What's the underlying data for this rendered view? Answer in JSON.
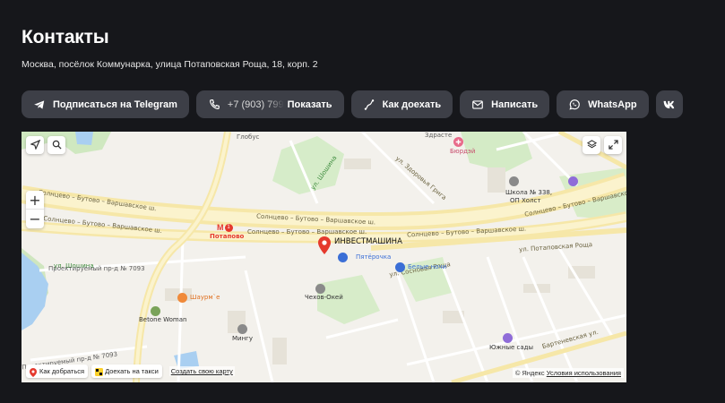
{
  "page": {
    "title": "Контакты",
    "address": "Москва, посёлок Коммунарка, улица Потаповская Роща, 18, корп. 2"
  },
  "actions": {
    "telegram": {
      "label": "Подписаться на Telegram",
      "icon": "telegram-icon"
    },
    "phone": {
      "number": "+7 (903) 799",
      "label": "Показать",
      "icon": "phone-icon"
    },
    "route": {
      "label": "Как доехать",
      "icon": "route-icon"
    },
    "write": {
      "label": "Написать",
      "icon": "mail-icon"
    },
    "whatsapp": {
      "label": "WhatsApp",
      "icon": "whatsapp-icon"
    },
    "vk": {
      "icon": "vk-icon"
    }
  },
  "map": {
    "marker_label": "ИНВЕСТМАШИНА",
    "labels": {
      "globus": "Глобус",
      "zdorove": "Здрасте",
      "byurdaj": "Бюрдэй",
      "school": "Школа № 338,",
      "school2": "ОП Холст",
      "shosh1": "ул. Шошина",
      "shosh2": "ул. Шошина",
      "metro": "Потапово",
      "pyaterochka": "Пятёрочка",
      "belye_nochi": "Белые ночи",
      "shaurme": "Шаурм`е",
      "betone": "Betone Woman",
      "chehov": "Чехов-Окей",
      "mingu": "Мингу",
      "yuzhnye_sady": "Южные сады",
      "proezd1": "Проектируемый пр-д № 7093",
      "proezd2": "Проектируемый пр-д № 7093",
      "road1": "Солнцево – Бутово – Варшавское ш.",
      "road2": "Солнцево – Бутово – Варшавское ш.",
      "road3": "Солнцево – Бутово – Варшавское ш.",
      "road4": "Солнцево – Бутово – Варшавское ш.",
      "road5": "Солнцево – Бутово – Варшавское ш.",
      "road6": "Солнцево – Бутово – Варшавское ш.",
      "zdravie": "ул. Здоровья Грига",
      "potap": "ул. Потаповская Роща",
      "sosnov": "ул. Сосновая Роща",
      "bartenev": "Бартеневская ул."
    },
    "controls": {
      "locate_icon": "locate-arrow-icon",
      "search_icon": "search-icon",
      "layers_icon": "layers-icon",
      "fullscreen_icon": "fullscreen-icon",
      "zoom_in": "+",
      "zoom_out": "−"
    },
    "bottom": {
      "route": "Как добраться",
      "taxi": "Доехать на такси",
      "create": "Создать свою карту",
      "copyright": "© Яндекс",
      "terms": "Условия использования"
    }
  },
  "colors": {
    "background": "#16171b",
    "button": "#3d3f47",
    "marker": "#e5392d",
    "metro": "#e5392d"
  }
}
